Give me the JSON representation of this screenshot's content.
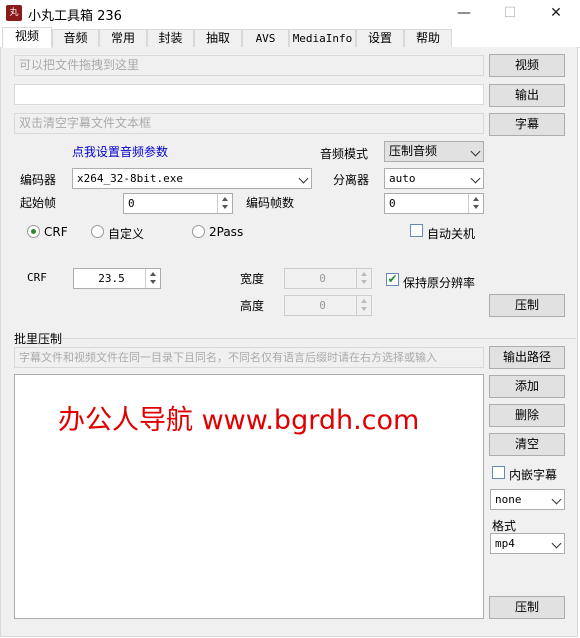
{
  "window": {
    "title": "小丸工具箱 236",
    "minimize": "—",
    "maximize": "☐",
    "close": "✕"
  },
  "tabs": [
    "视频",
    "音频",
    "常用",
    "封装",
    "抽取",
    "AVS",
    "MediaInfo",
    "设置",
    "帮助"
  ],
  "video": {
    "drop_placeholder": "可以把文件拖拽到这里",
    "output_value": "",
    "subtitle_placeholder": "双击清空字幕文件文本框",
    "btn_video": "视频",
    "btn_output": "输出",
    "btn_subtitle": "字幕",
    "audio_params_link": "点我设置音频参数",
    "audio_mode_label": "音频模式",
    "audio_mode_value": "压制音频",
    "encoder_label": "编码器",
    "encoder_value": "x264_32-8bit.exe",
    "splitter_label": "分离器",
    "splitter_value": "auto",
    "start_frame_label": "起始帧",
    "start_frame_value": "0",
    "encode_frames_label": "编码帧数",
    "encode_frames_value": "0",
    "radio_crf": "CRF",
    "radio_custom": "自定义",
    "radio_2pass": "2Pass",
    "auto_shutdown": "自动关机",
    "crf_label": "CRF",
    "crf_value": "23.5",
    "width_label": "宽度",
    "width_value": "0",
    "height_label": "高度",
    "height_value": "0",
    "keep_resolution": "保持原分辨率",
    "btn_encode": "压制"
  },
  "batch": {
    "section_label": "批里压制",
    "hint": "字幕文件和视频文件在同一目录下且同名，不同名仅有语言后缀时请在右方选择或输入",
    "btn_output_path": "输出路径",
    "btn_add": "添加",
    "btn_delete": "删除",
    "btn_clear": "清空",
    "embed_subtitle": "内嵌字幕",
    "subtitle_lang_value": "none",
    "format_label": "格式",
    "format_value": "mp4",
    "btn_encode": "压制",
    "watermark": "办公人导航 www.bgrdh.com"
  },
  "colors": {
    "link": "#0000cc",
    "watermark": "#e00000",
    "check": "#2a8a2a"
  }
}
